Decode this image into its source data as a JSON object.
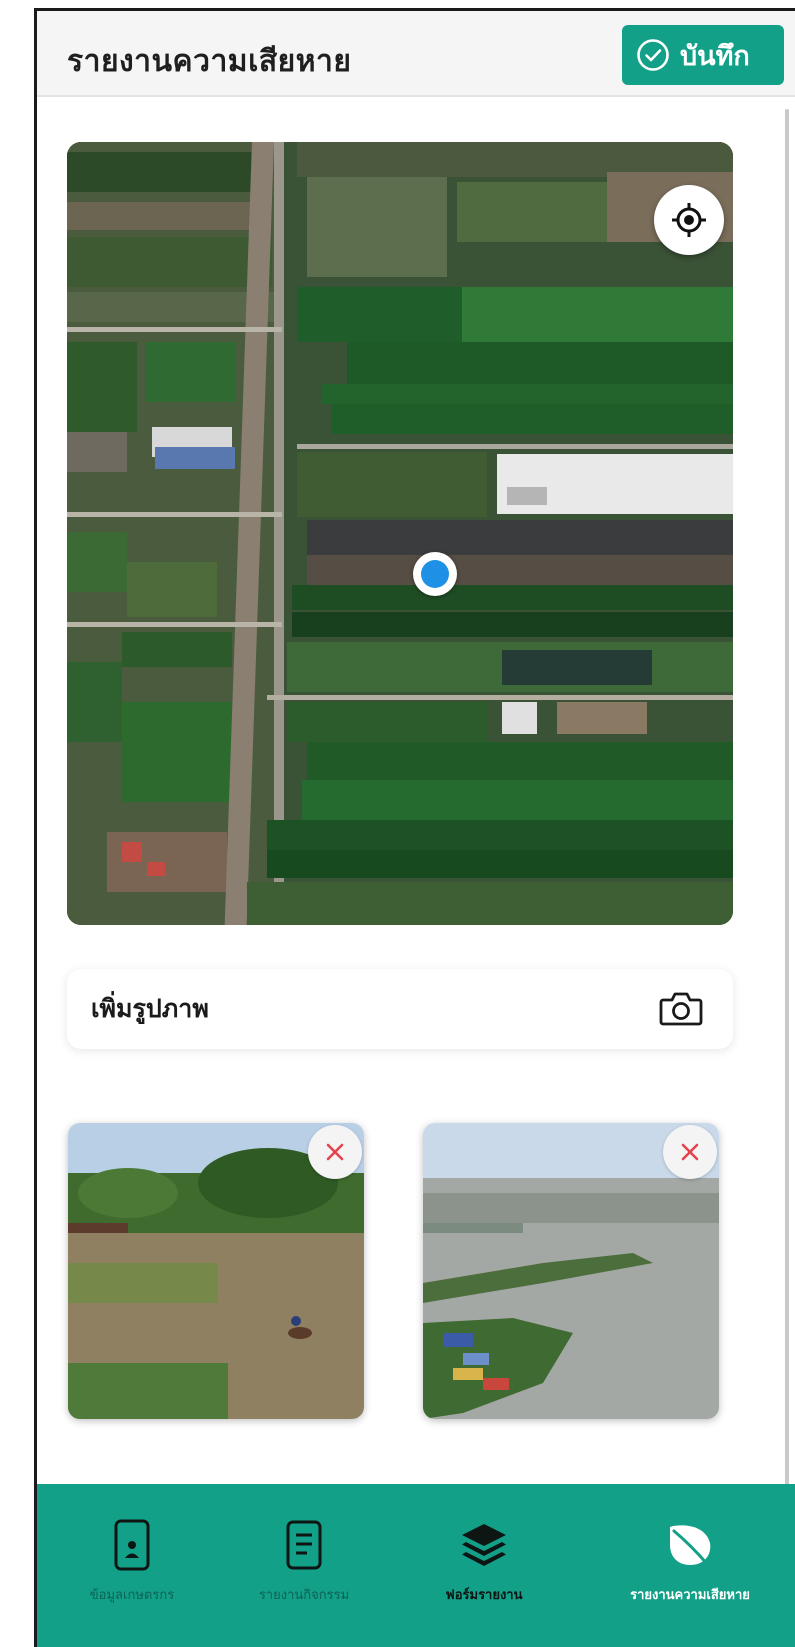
{
  "header": {
    "title": "รายงานความเสียหาย",
    "save_label": "บันทึก"
  },
  "map": {
    "locate_icon": "crosshair-icon",
    "pin_color": "#1e90e6"
  },
  "add_photo": {
    "label": "เพิ่มรูปภาพ",
    "icon": "camera-icon"
  },
  "photos": [
    {
      "remove_icon": "close-icon"
    },
    {
      "remove_icon": "close-icon"
    }
  ],
  "bottom_nav": {
    "items": [
      {
        "label": "ข้อมูลเกษตรกร",
        "icon": "phone-user-icon",
        "state": "inactive"
      },
      {
        "label": "รายงานกิจกรรม",
        "icon": "document-icon",
        "state": "inactive"
      },
      {
        "label": "ฟอร์มรายงาน",
        "icon": "layers-icon",
        "state": "dark"
      },
      {
        "label": "รายงานความเสียหาย",
        "icon": "leaf-icon",
        "state": "active"
      }
    ]
  },
  "colors": {
    "brand": "#13a088",
    "remove": "#e8424c"
  }
}
